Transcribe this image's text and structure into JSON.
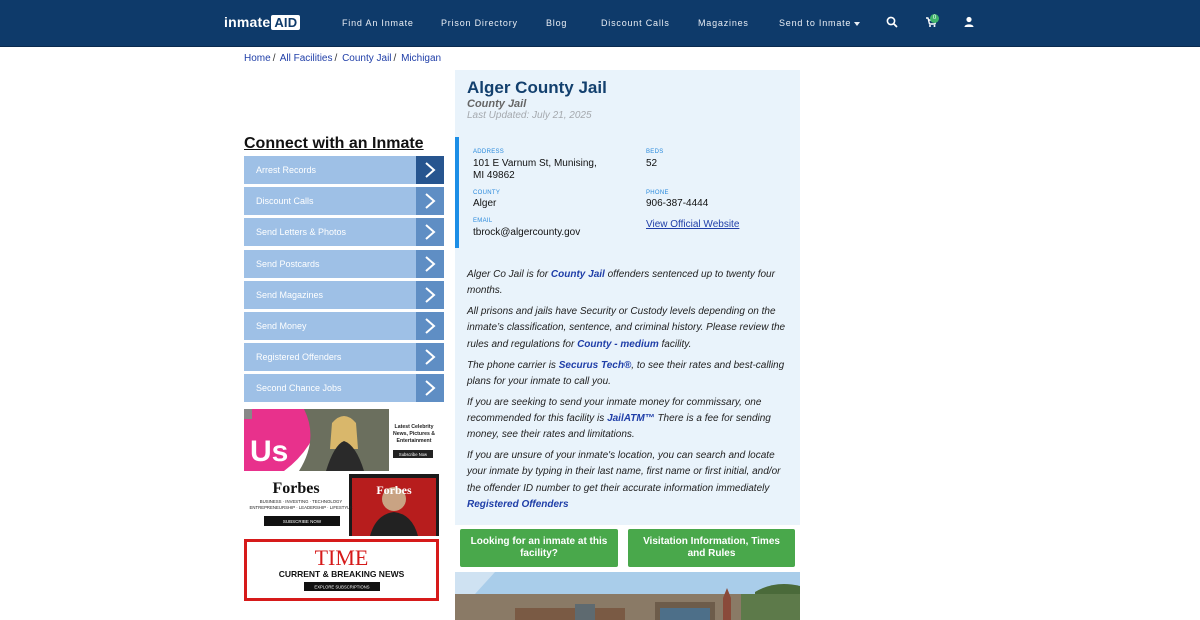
{
  "nav": {
    "logo_prefix": "inmate",
    "logo_suffix": "AID",
    "items": [
      "Find An Inmate",
      "Prison Directory",
      "Blog",
      "Discount Calls",
      "Magazines",
      "Send to Inmate"
    ],
    "cart_count": "0"
  },
  "breadcrumb": [
    "Home",
    "All Facilities",
    "County Jail",
    "Michigan"
  ],
  "sidebar": {
    "title": "Connect with an Inmate",
    "items": [
      "Arrest Records",
      "Discount Calls",
      "Send Letters & Photos",
      "Send Postcards",
      "Send Magazines",
      "Send Money",
      "Registered Offenders",
      "Second Chance Jobs"
    ]
  },
  "ads": {
    "us": {
      "brand": "Us",
      "tagline1": "Latest Celebrity",
      "tagline2": "News, Pictures &",
      "tagline3": "Entertainment",
      "cta": "Subscribe Now"
    },
    "forbes": {
      "brand": "Forbes",
      "line1": "BUSINESS · INVESTING · TECHNOLOGY",
      "line2": "ENTREPRENEURSHIP · LEADERSHIP · LIFESTYLE",
      "cta": "SUBSCRIBE NOW"
    },
    "time": {
      "brand": "TIME",
      "tagline": "CURRENT & BREAKING NEWS",
      "cta": "EXPLORE SUBSCRIPTIONS"
    }
  },
  "facility": {
    "name": "Alger County Jail",
    "type": "County Jail",
    "updated": "Last Updated: July 21, 2025",
    "address_label": "ADDRESS",
    "address_line1": "101 E Varnum St, Munising,",
    "address_line2": "MI 49862",
    "beds_label": "BEDS",
    "beds": "52",
    "county_label": "COUNTY",
    "county": "Alger",
    "phone_label": "PHONE",
    "phone": "906-387-4444",
    "email_label": "EMAIL",
    "email": "tbrock@algercounty.gov",
    "website_link": "View Official Website"
  },
  "description": {
    "p1_a": "Alger Co Jail is for ",
    "p1_link": "County Jail",
    "p1_b": " offenders sentenced up to twenty four months.",
    "p2_a": "All prisons and jails have Security or Custody levels depending on the inmate’s classification, sentence, and criminal history. Please review the rules and regulations for ",
    "p2_link": "County - medium",
    "p2_b": " facility.",
    "p3_a": "The phone carrier is ",
    "p3_link": "Securus Tech®",
    "p3_b": ", to see their rates and best-calling plans for your inmate to call you.",
    "p4_a": "If you are seeking to send your inmate money for commissary, one recommended for this facility is ",
    "p4_link": "JailATM™",
    "p4_b": " There is a fee for sending money, see their rates and limitations.",
    "p5_a": "If you are unsure of your inmate's location, you can search and locate your inmate by typing in their last name, first name or first initial, and/or the offender ID number to get their accurate information immediately ",
    "p5_link": "Registered Offenders"
  },
  "buttons": {
    "looking": "Looking for an inmate at this facility?",
    "visitation": "Visitation Information, Times and Rules"
  }
}
